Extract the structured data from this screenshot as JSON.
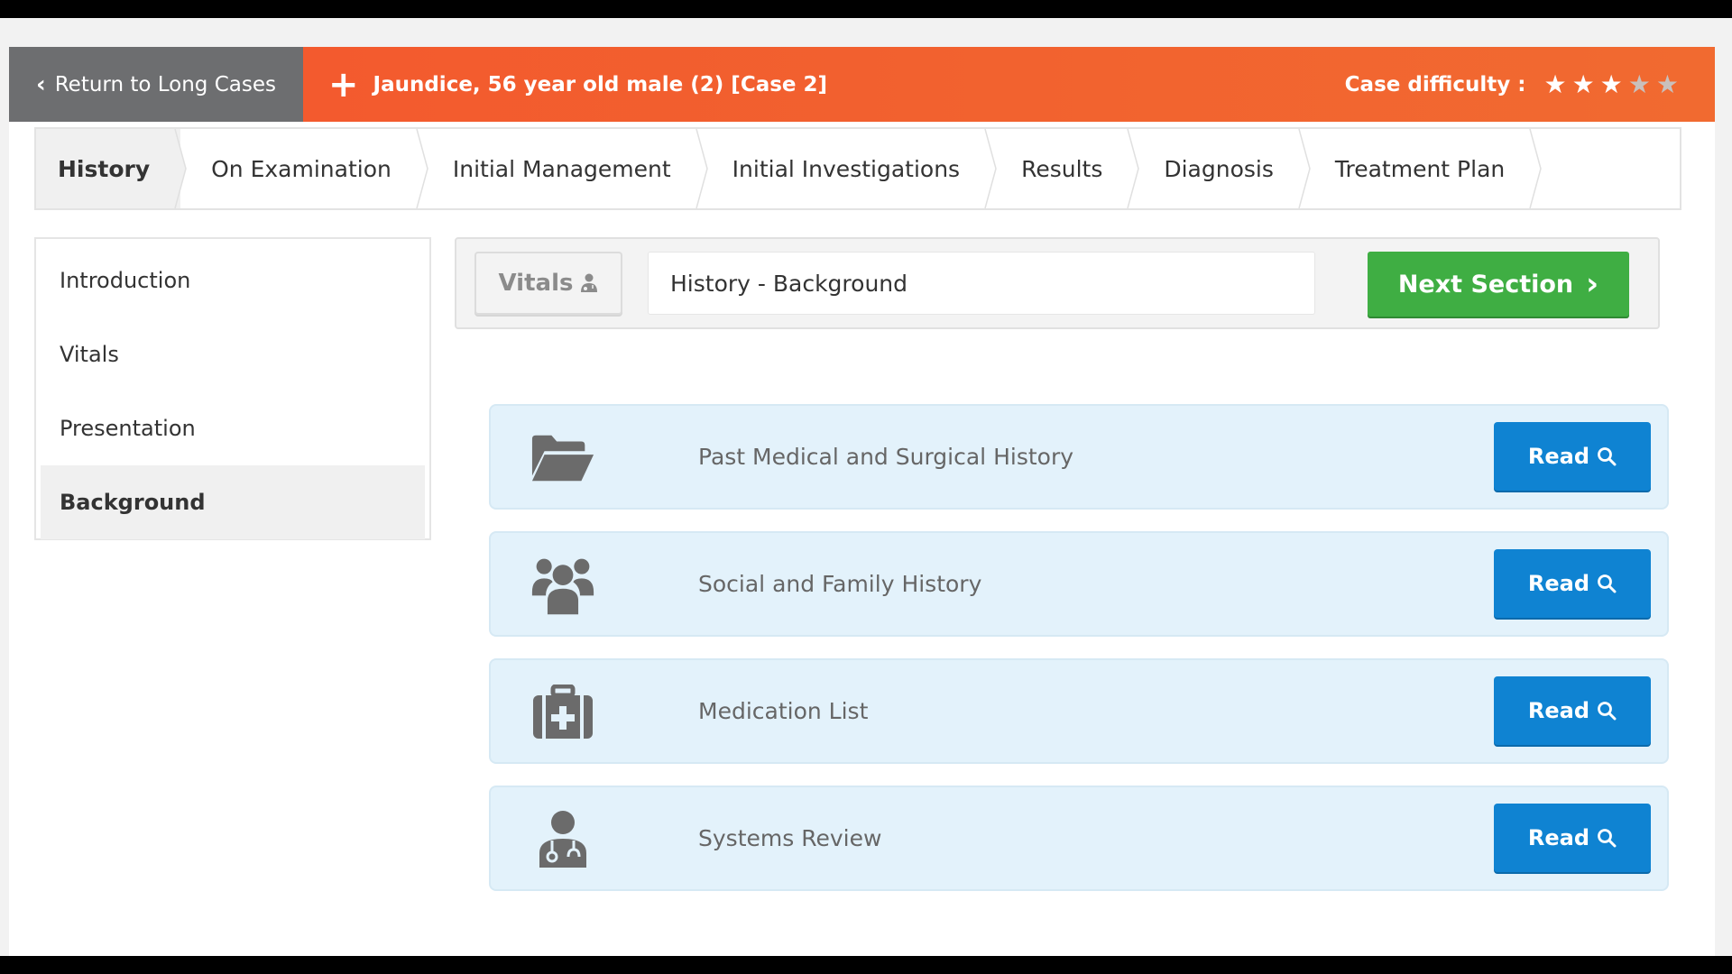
{
  "header": {
    "back_label": "Return to Long Cases",
    "case_title": "Jaundice, 56 year old male (2) [Case 2]",
    "difficulty_label": "Case difficulty :",
    "difficulty_rating": 3,
    "difficulty_max": 5,
    "accent_color": "#f35a2e"
  },
  "tabs": [
    {
      "label": "History",
      "active": true
    },
    {
      "label": "On Examination",
      "active": false
    },
    {
      "label": "Initial Management",
      "active": false
    },
    {
      "label": "Initial Investigations",
      "active": false
    },
    {
      "label": "Results",
      "active": false
    },
    {
      "label": "Diagnosis",
      "active": false
    },
    {
      "label": "Treatment Plan",
      "active": false
    }
  ],
  "sidenav": {
    "items": [
      {
        "label": "Introduction",
        "active": false
      },
      {
        "label": "Vitals",
        "active": false
      },
      {
        "label": "Presentation",
        "active": false
      },
      {
        "label": "Background",
        "active": true
      }
    ]
  },
  "toolbar": {
    "vitals_label": "Vitals",
    "vitals_icon": "doctor-icon",
    "section_value": "History - Background",
    "next_label": "Next Section",
    "next_color": "#3fae43"
  },
  "cards": [
    {
      "label": "Past Medical and Surgical History",
      "icon": "folder-open-icon",
      "button": "Read"
    },
    {
      "label": "Social and Family History",
      "icon": "users-icon",
      "button": "Read"
    },
    {
      "label": "Medication List",
      "icon": "medkit-icon",
      "button": "Read"
    },
    {
      "label": "Systems Review",
      "icon": "doctor-icon",
      "button": "Read"
    }
  ]
}
